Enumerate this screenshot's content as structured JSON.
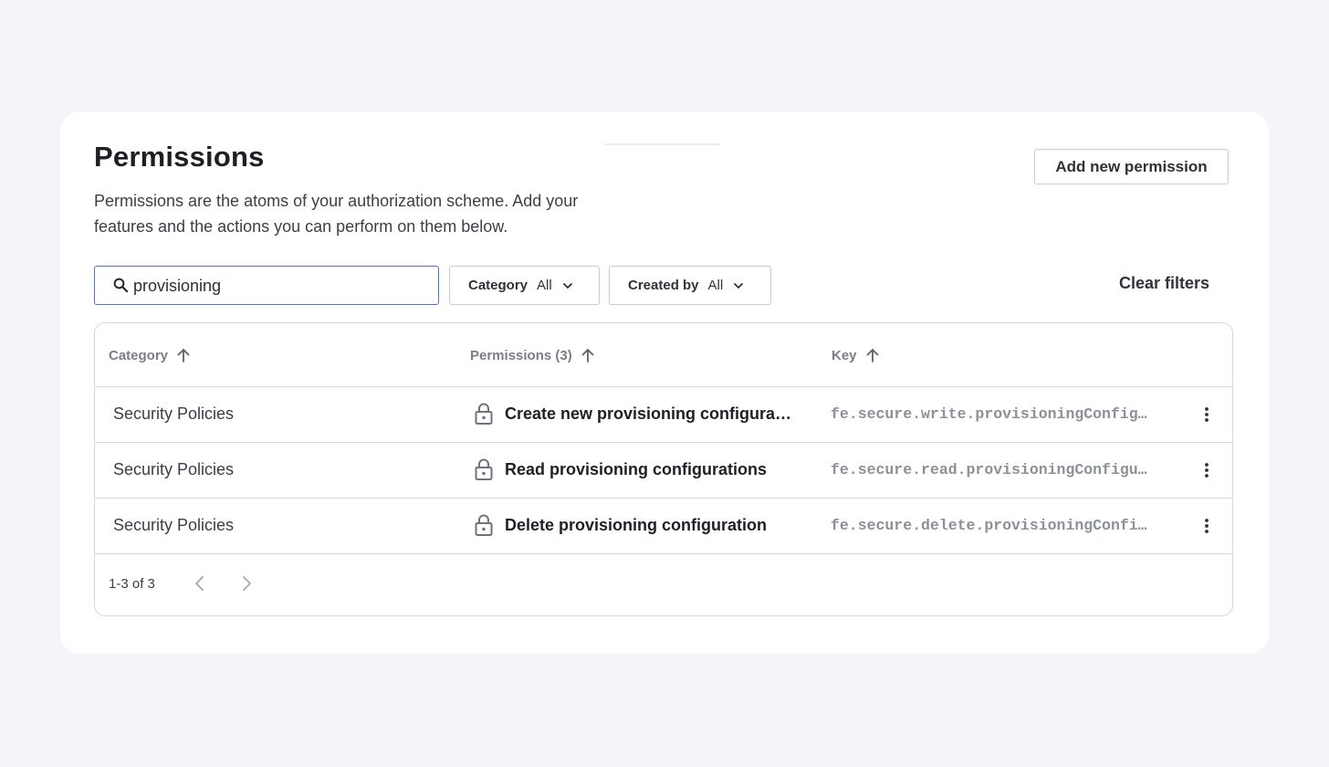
{
  "header": {
    "title": "Permissions",
    "description": "Permissions are the atoms of your authorization scheme. Add your features and the actions you can perform on them below.",
    "add_button_label": "Add new permission"
  },
  "filters": {
    "search_value": "provisioning",
    "category_label": "Category",
    "category_value": "All",
    "created_by_label": "Created by",
    "created_by_value": "All",
    "clear_label": "Clear filters"
  },
  "table": {
    "columns": {
      "category": "Category",
      "permissions": "Permissions (3)",
      "key": "Key"
    },
    "rows": [
      {
        "category": "Security Policies",
        "permission": "Create new provisioning configurat…",
        "key": "fe.secure.write.provisioningConfig…"
      },
      {
        "category": "Security Policies",
        "permission": "Read provisioning configurations",
        "key": "fe.secure.read.provisioningConfigu…"
      },
      {
        "category": "Security Policies",
        "permission": "Delete provisioning configuration",
        "key": "fe.secure.delete.provisioningConfi…"
      }
    ],
    "pagination": {
      "range": "1-3 of 3"
    }
  },
  "icons": {
    "search": "search-icon",
    "chevron": "chevron-down-icon",
    "sort": "arrow-up-icon",
    "lock": "lock-icon",
    "more": "more-vertical-icon",
    "prev": "chevron-left-icon",
    "next": "chevron-right-icon"
  },
  "colors": {
    "background": "#f4f5f9",
    "card": "#ffffff",
    "focus_border": "#4b73c7",
    "border": "#d6d8de",
    "muted_text": "#8c9097"
  }
}
